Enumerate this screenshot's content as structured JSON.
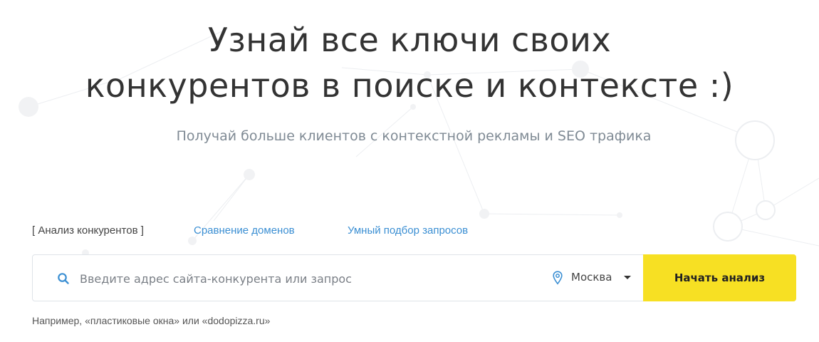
{
  "hero": {
    "title_line1": "Узнай все ключи своих",
    "title_line2": "конкурентов в поиске и контексте :)",
    "subtitle": "Получай больше клиентов с контекстной рекламы и SEO трафика"
  },
  "tabs": [
    {
      "label": "[ Анализ конкурентов ]",
      "active": true
    },
    {
      "label": "Сравнение доменов",
      "active": false
    },
    {
      "label": "Умный подбор запросов",
      "active": false
    }
  ],
  "search": {
    "icon": "search-icon",
    "value": "",
    "placeholder": "Введите адрес сайта-конкурента или запрос",
    "region_icon": "location-pin-icon",
    "region": "Москва",
    "submit_label": "Начать анализ"
  },
  "example": {
    "prefix": "Например, ",
    "query": "«пластиковые окна»",
    "joiner": " или ",
    "domain": "«dodopizza.ru»"
  },
  "colors": {
    "accent_button": "#f7e023",
    "link": "#3b8fd3",
    "title": "#333333",
    "subtitle": "#7f8a94"
  }
}
